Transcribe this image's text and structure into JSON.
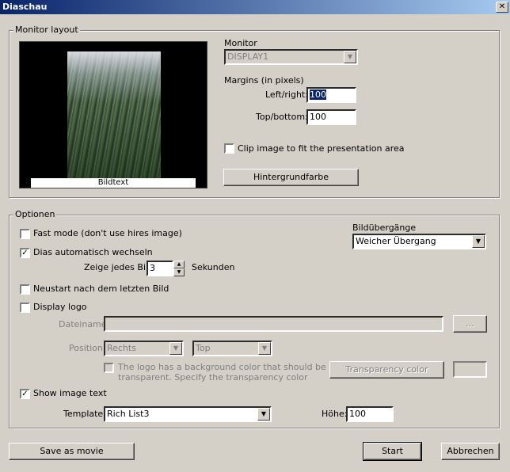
{
  "window": {
    "title": "Diaschau",
    "close_glyph": "✕"
  },
  "monitor_layout": {
    "legend": "Monitor layout",
    "preview_caption": "Bildtext",
    "monitor_label": "Monitor",
    "monitor_value": "DISPLAY1",
    "margins_label": "Margins (in pixels)",
    "left_right_label": "Left/right:",
    "left_right_value": "100",
    "top_bottom_label": "Top/bottom:",
    "top_bottom_value": "100",
    "clip_label": "Clip image to fit the presentation area",
    "clip_checked": false,
    "bg_color_button": "Hintergrundfarbe"
  },
  "optionen": {
    "legend": "Optionen",
    "fast_mode_label": "Fast mode (don't use hires image)",
    "fast_mode_checked": false,
    "auto_switch_label": "Dias automatisch wechseln",
    "auto_switch_checked": true,
    "show_each_label": "Zeige jedes Bild",
    "show_each_value": "3",
    "seconds_label": "Sekunden",
    "transitions_label": "Bildübergänge",
    "transitions_value": "Weicher Übergang",
    "restart_label": "Neustart nach dem letzten Bild",
    "restart_checked": false,
    "display_logo_label": "Display logo",
    "display_logo_checked": false,
    "filename_label": "Dateiname:",
    "filename_value": "",
    "browse_button": "...",
    "position_label": "Position:",
    "position_h_value": "Rechts",
    "position_v_value": "Top",
    "logo_bg_label_line1": "The logo has a background color that should be",
    "logo_bg_label_line2": "transparent. Specify the transparency color",
    "transparency_button": "Transparency color",
    "show_text_label": "Show image text",
    "show_text_checked": true,
    "template_label": "Template:",
    "template_value": "Rich List3",
    "height_label": "Höhe:",
    "height_value": "100"
  },
  "footer": {
    "save_movie_button": "Save as movie",
    "start_button": "Start",
    "cancel_button": "Abbrechen"
  },
  "glyphs": {
    "check": "✓",
    "down_arrow": "▼",
    "up_small": "▲",
    "down_small": "▼"
  }
}
